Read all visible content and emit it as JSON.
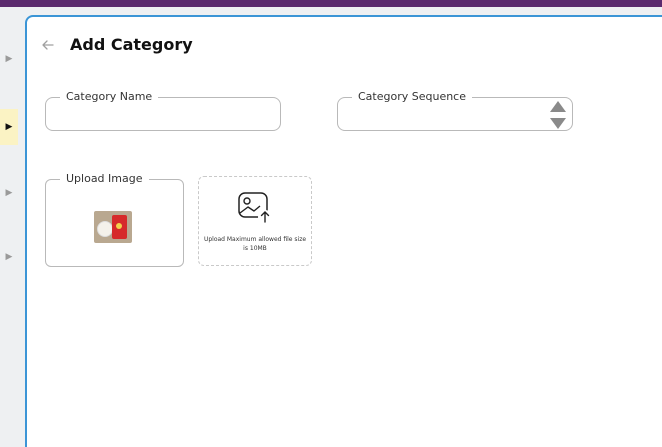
{
  "page": {
    "title": "Add Category"
  },
  "form": {
    "category_name": {
      "label": "Category Name",
      "value": ""
    },
    "category_sequence": {
      "label": "Category Sequence",
      "value": ""
    },
    "upload": {
      "label": "Upload Image",
      "hint": "Upload Maximum allowed file size is 10MB"
    }
  },
  "icons": {
    "back": "arrow-left-icon",
    "upload": "image-upload-icon",
    "rail": [
      "chevron-right-icon",
      "chevron-right-icon",
      "chevron-right-icon",
      "chevron-right-icon"
    ]
  },
  "colors": {
    "topbar": "#5b2a6e",
    "panel_border": "#3b95d6",
    "active_rail": "#fbf3c4"
  }
}
